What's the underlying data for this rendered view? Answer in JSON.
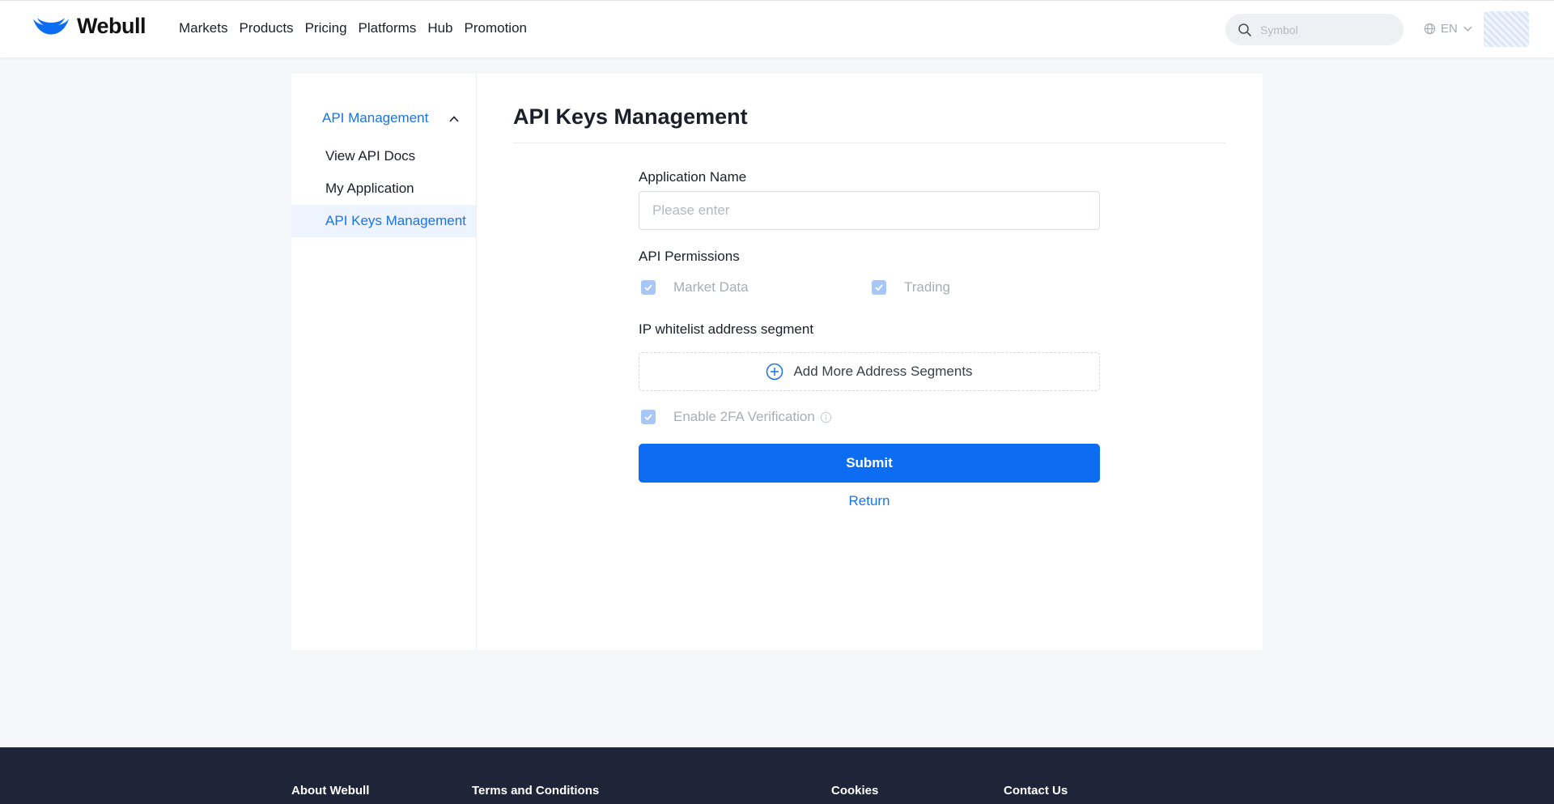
{
  "header": {
    "brand": "Webull",
    "nav": [
      {
        "label": "Markets"
      },
      {
        "label": "Products"
      },
      {
        "label": "Pricing"
      },
      {
        "label": "Platforms"
      },
      {
        "label": "Hub"
      },
      {
        "label": "Promotion"
      }
    ],
    "search_placeholder": "Symbol",
    "language": "EN",
    "brand_color": "#0c6cf2"
  },
  "sidebar": {
    "group_label": "API Management",
    "items": [
      {
        "label": "View API Docs",
        "active": false
      },
      {
        "label": "My Application",
        "active": false
      },
      {
        "label": "API Keys Management",
        "active": true
      }
    ]
  },
  "main": {
    "title": "API Keys Management",
    "app_name_label": "Application Name",
    "app_name_placeholder": "Please enter",
    "app_name_value": "",
    "permissions_label": "API Permissions",
    "permissions": [
      {
        "label": "Market Data",
        "checked": true
      },
      {
        "label": "Trading",
        "checked": true
      }
    ],
    "ip_label": "IP whitelist address segment",
    "add_segment_label": "Add More Address Segments",
    "twofa_label": "Enable 2FA Verification",
    "twofa_checked": true,
    "submit_label": "Submit",
    "return_label": "Return"
  },
  "footer": {
    "links": [
      {
        "label": "About Webull"
      },
      {
        "label": "Terms and Conditions"
      },
      {
        "label": "Cookies"
      },
      {
        "label": "Contact Us"
      }
    ]
  }
}
